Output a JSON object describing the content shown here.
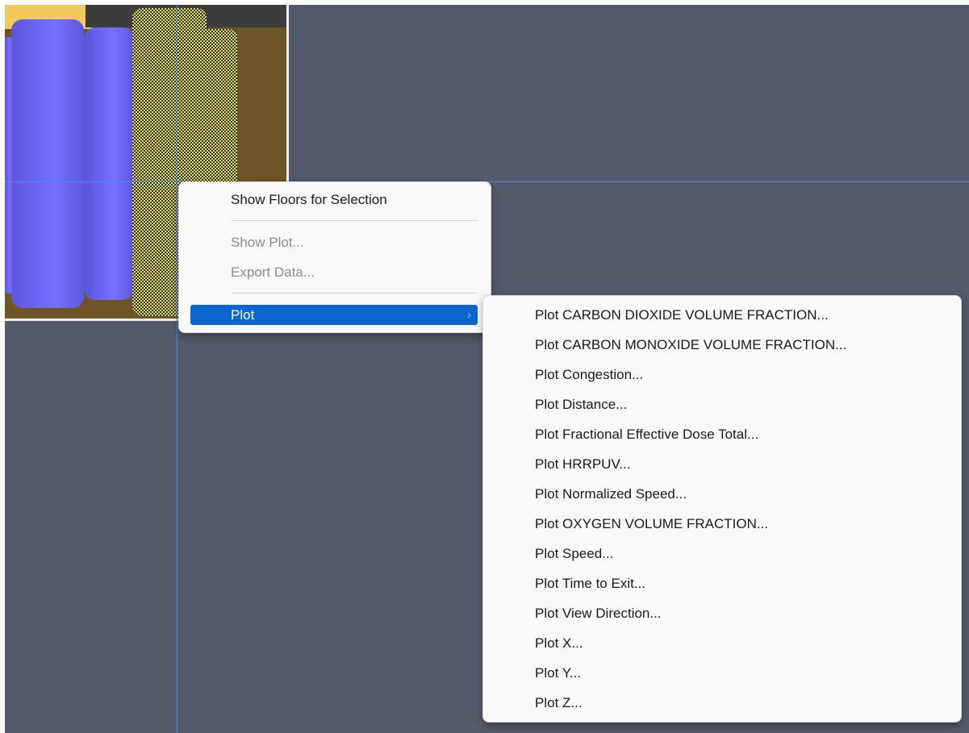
{
  "context_menu": {
    "items": [
      {
        "label": "Show Floors for Selection",
        "enabled": true
      },
      {
        "label": "Show Plot...",
        "enabled": false
      },
      {
        "label": "Export Data...",
        "enabled": false
      },
      {
        "label": "Plot",
        "enabled": true,
        "highlighted": true,
        "has_submenu": true
      }
    ],
    "submenu_arrow": "›"
  },
  "plot_submenu": {
    "items": [
      "Plot CARBON DIOXIDE VOLUME FRACTION...",
      "Plot CARBON MONOXIDE VOLUME FRACTION...",
      "Plot Congestion...",
      "Plot Distance...",
      "Plot Fractional Effective Dose Total...",
      "Plot HRRPUV...",
      "Plot Normalized Speed...",
      "Plot OXYGEN VOLUME FRACTION...",
      "Plot Speed...",
      "Plot Time to Exit...",
      "Plot View Direction...",
      "Plot X...",
      "Plot Y...",
      "Plot Z..."
    ]
  },
  "colors": {
    "viewport_background": "#545a6b",
    "menu_highlight": "#0d66d0",
    "guide_line": "#4a90e2"
  }
}
